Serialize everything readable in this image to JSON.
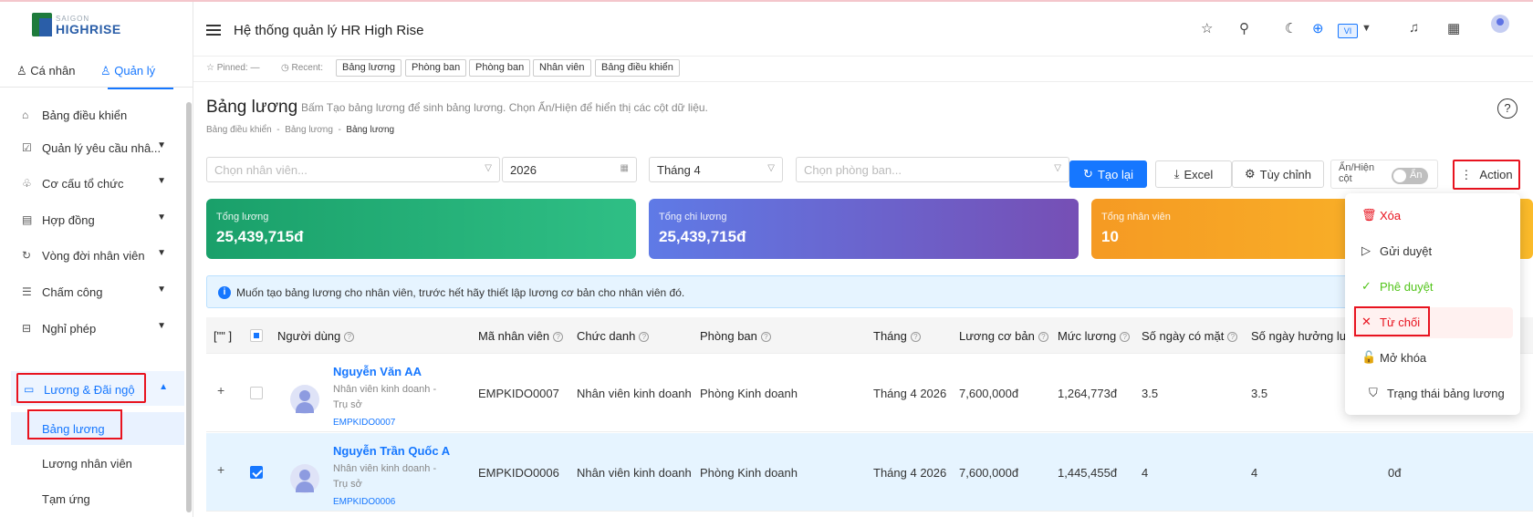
{
  "brand": {
    "small": "SAIGON",
    "big": "HIGHRISE"
  },
  "sidebar": {
    "tabs": [
      {
        "label": "Cá nhân"
      },
      {
        "label": "Quản lý"
      }
    ],
    "items": [
      {
        "label": "Bảng điều khiển"
      },
      {
        "label": "Quản lý yêu cầu nhâ..."
      },
      {
        "label": "Cơ cấu tổ chức"
      },
      {
        "label": "Hợp đồng"
      },
      {
        "label": "Vòng đời nhân viên"
      },
      {
        "label": "Chấm công"
      },
      {
        "label": "Nghỉ phép"
      },
      {
        "label": "Lương & Đãi ngộ"
      }
    ],
    "subitems": [
      {
        "label": "Bảng lương"
      },
      {
        "label": "Lương nhân viên"
      },
      {
        "label": "Tạm ứng"
      }
    ]
  },
  "header": {
    "title": "Hệ thống quản lý HR High Rise",
    "lang": "VI"
  },
  "pinbar": {
    "pinned": "☆ Pinned: —",
    "recent": "Recent:",
    "chips": [
      "Bảng lương",
      "Phòng ban",
      "Phòng ban",
      "Nhân viên",
      "Bảng điều khiển"
    ]
  },
  "page": {
    "title": "Bảng lương",
    "subtitle": "Bấm Tạo bảng lương để sinh bảng lương. Chọn Ẩn/Hiện để hiển thị các cột dữ liệu.",
    "breadcrumb": [
      "Bảng điều khiển",
      "Bảng lương",
      "Bảng lương"
    ]
  },
  "filters": {
    "employee_placeholder": "Chọn nhân viên...",
    "year": "2026",
    "month": "Tháng 4",
    "department_placeholder": "Chọn phòng ban..."
  },
  "buttons": {
    "reload": "Tạo lại",
    "excel": "Excel",
    "customize": "Tùy chỉnh",
    "toggle_label": "Ẩn/Hiện cột",
    "toggle_state": "Ẩn",
    "action": "Action"
  },
  "cards": [
    {
      "label": "Tổng lương",
      "value": "25,439,715đ",
      "color": "#1aa06a"
    },
    {
      "label": "Tổng chi lương",
      "value": "25,439,715đ",
      "color": "#6c63d9"
    },
    {
      "label": "Tổng nhân viên",
      "value": "10",
      "color": "#f5a623"
    }
  ],
  "info": "Muốn tạo bảng lương cho nhân viên, trước hết hãy thiết lập lương cơ bản cho nhân viên đó.",
  "table": {
    "columns": [
      "[\"\" ]",
      "Người dùng",
      "Mã nhân viên",
      "Chức danh",
      "Phòng ban",
      "Tháng",
      "Lương cơ bản",
      "Mức lương",
      "Số ngày có mặt",
      "Số ngày hưởng lư"
    ],
    "rows": [
      {
        "name": "Nguyễn Văn AA",
        "role": "Nhân viên kinh doanh - Trụ sở",
        "code": "EMPKIDO0007",
        "emp_id": "EMPKIDO0007",
        "title": "Nhân viên kinh doanh",
        "dept": "Phòng Kinh doanh",
        "month": "Tháng 4 2026",
        "base": "7,600,000đ",
        "salary": "1,264,773đ",
        "present": "3.5",
        "paid_days": "3.5",
        "extra": "",
        "selected": false
      },
      {
        "name": "Nguyễn Trần Quốc A",
        "role": "Nhân viên kinh doanh - Trụ sở",
        "code": "EMPKIDO0006",
        "emp_id": "EMPKIDO0006",
        "title": "Nhân viên kinh doanh",
        "dept": "Phòng Kinh doanh",
        "month": "Tháng 4 2026",
        "base": "7,600,000đ",
        "salary": "1,445,455đ",
        "present": "4",
        "paid_days": "4",
        "extra": "0đ",
        "selected": true
      }
    ]
  },
  "action_menu": [
    {
      "label": "Xóa",
      "icon": "trash-icon",
      "color": "#e8131f"
    },
    {
      "label": "Gửi duyệt",
      "icon": "send-icon",
      "color": "#333333"
    },
    {
      "label": "Phê duyệt",
      "icon": "check-icon",
      "color": "#52c41a"
    },
    {
      "label": "Từ chối",
      "icon": "close-icon",
      "color": "#e8131f"
    },
    {
      "label": "Mở khóa",
      "icon": "unlock-icon",
      "color": "#333333"
    },
    {
      "label": "Trạng thái bảng lương",
      "icon": "shield-icon",
      "color": "#333333"
    }
  ]
}
